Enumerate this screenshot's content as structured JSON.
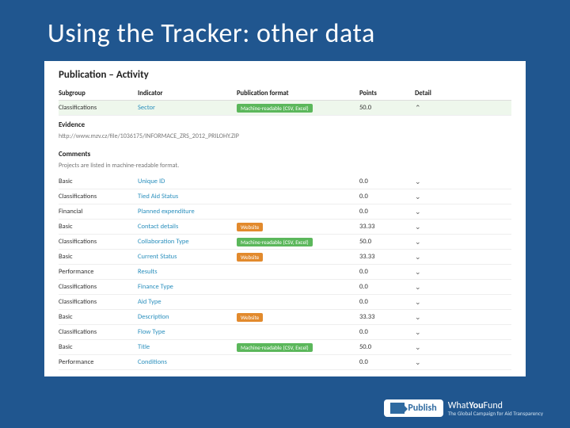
{
  "slide": {
    "title": "Using the Tracker: other data"
  },
  "panel": {
    "title": "Publication – Activity",
    "headers": {
      "subgroup": "Subgroup",
      "indicator": "Indicator",
      "format": "Publication format",
      "points": "Points",
      "detail": "Detail"
    },
    "highlight": {
      "subgroup": "Classifications",
      "indicator": "Sector",
      "format": "Machine-readable (CSV, Excel)",
      "points": "50.0"
    },
    "evidence": {
      "heading": "Evidence",
      "text": "http://www.mzv.cz/file/1036175/INFORMACE_ZRS_2012_PRILOHY.ZIP"
    },
    "comments": {
      "heading": "Comments",
      "text": "Projects are listed in machine-readable format."
    },
    "rows": [
      {
        "subgroup": "Basic",
        "indicator": "Unique ID",
        "format": "",
        "badge": "",
        "points": "0.0"
      },
      {
        "subgroup": "Classifications",
        "indicator": "Tied Aid Status",
        "format": "",
        "badge": "",
        "points": "0.0"
      },
      {
        "subgroup": "Financial",
        "indicator": "Planned expenditure",
        "format": "",
        "badge": "",
        "points": "0.0"
      },
      {
        "subgroup": "Basic",
        "indicator": "Contact details",
        "format": "Website",
        "badge": "orange",
        "points": "33.33"
      },
      {
        "subgroup": "Classifications",
        "indicator": "Collaboration Type",
        "format": "Machine-readable (CSV, Excel)",
        "badge": "green",
        "points": "50.0"
      },
      {
        "subgroup": "Basic",
        "indicator": "Current Status",
        "format": "Website",
        "badge": "orange",
        "points": "33.33"
      },
      {
        "subgroup": "Performance",
        "indicator": "Results",
        "format": "",
        "badge": "",
        "points": "0.0"
      },
      {
        "subgroup": "Classifications",
        "indicator": "Finance Type",
        "format": "",
        "badge": "",
        "points": "0.0"
      },
      {
        "subgroup": "Classifications",
        "indicator": "Aid Type",
        "format": "",
        "badge": "",
        "points": "0.0"
      },
      {
        "subgroup": "Basic",
        "indicator": "Description",
        "format": "Website",
        "badge": "orange",
        "points": "33.33"
      },
      {
        "subgroup": "Classifications",
        "indicator": "Flow Type",
        "format": "",
        "badge": "",
        "points": "0.0"
      },
      {
        "subgroup": "Basic",
        "indicator": "Title",
        "format": "Machine-readable (CSV, Excel)",
        "badge": "green",
        "points": "50.0"
      },
      {
        "subgroup": "Performance",
        "indicator": "Conditions",
        "format": "",
        "badge": "",
        "points": "0.0"
      }
    ]
  },
  "logo": {
    "publish": "Publish",
    "what": "What",
    "you": "You",
    "fund": "Fund",
    "tagline": "The Global Campaign for Aid Transparency"
  },
  "icons": {
    "info": "ℹ",
    "chev": "⌄"
  }
}
